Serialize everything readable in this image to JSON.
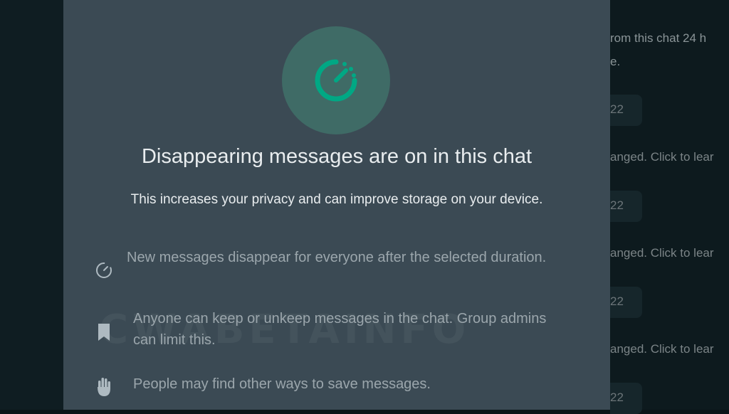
{
  "modal": {
    "title": "Disappearing messages are on in this chat",
    "subtitle": "This increases your privacy and can improve storage on your device.",
    "features": [
      {
        "icon": "timer-icon",
        "text": "New messages disappear for everyone after the selected duration."
      },
      {
        "icon": "bookmark-icon",
        "text": "Anyone can keep or unkeep messages in the chat. Group admins can limit this."
      },
      {
        "icon": "hand-icon",
        "text": "People may find other ways to save messages."
      }
    ],
    "watermark": "CWABETAINFO",
    "accent_color": "#00a884"
  },
  "background": {
    "messages": [
      {
        "text": "rom this chat 24 h"
      },
      {
        "text": "e."
      },
      {
        "text": "22"
      },
      {
        "text": "anged. Click to lear"
      },
      {
        "text": "22"
      },
      {
        "text": "anged. Click to lear"
      },
      {
        "text": "22"
      },
      {
        "text": "anged. Click to lear"
      },
      {
        "text": "22"
      }
    ]
  }
}
